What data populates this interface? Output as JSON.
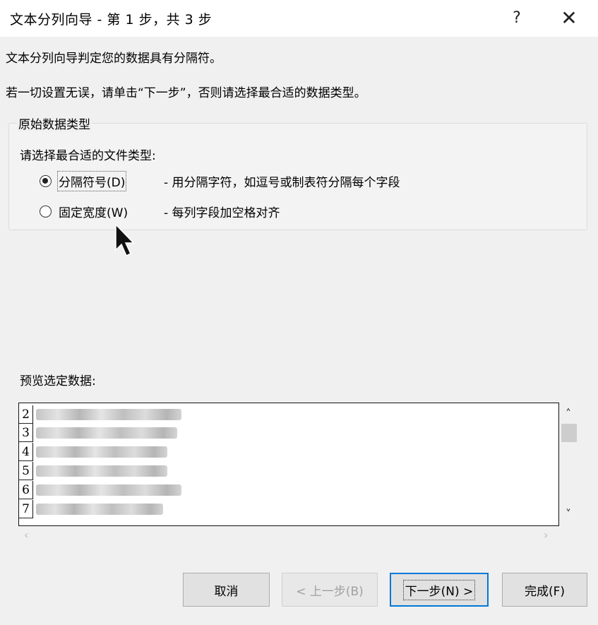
{
  "window": {
    "title": "文本分列向导 - 第 1 步，共 3 步",
    "help_label": "?",
    "close_label": "✕"
  },
  "intro": {
    "line1": "文本分列向导判定您的数据具有分隔符。",
    "line2": "若一切设置无误，请单击“下一步”，否则请选择最合适的数据类型。"
  },
  "original_data_type": {
    "legend": "原始数据类型",
    "prompt": "请选择最合适的文件类型:",
    "options": [
      {
        "label": "分隔符号(D)",
        "description": "- 用分隔字符，如逗号或制表符分隔每个字段",
        "selected": true
      },
      {
        "label": "固定宽度(W)",
        "description": "- 每列字段加空格对齐",
        "selected": false
      }
    ]
  },
  "preview": {
    "label": "预览选定数据:",
    "row_numbers": [
      "2",
      "3",
      "4",
      "5",
      "6",
      "7"
    ]
  },
  "buttons": {
    "cancel": "取消",
    "back": "< 上一步(B)",
    "next": "下一步(N) >",
    "finish": "完成(F)"
  },
  "colors": {
    "accent": "#0078d7",
    "dialog_bg": "#f0f0f0",
    "disabled_text": "#a0a0a0"
  },
  "icons": {
    "help": "help-icon",
    "close": "close-icon",
    "scroll_up": "chevron-up-icon",
    "scroll_down": "chevron-down-icon",
    "scroll_left": "chevron-left-icon",
    "scroll_right": "chevron-right-icon"
  }
}
